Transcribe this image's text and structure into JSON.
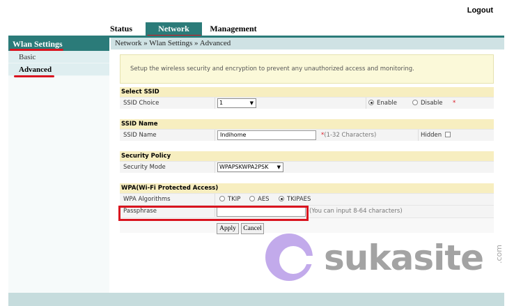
{
  "header": {
    "logout_label": "Logout"
  },
  "tabs": [
    {
      "label": "Status"
    },
    {
      "label": "Network"
    },
    {
      "label": "Management"
    }
  ],
  "sidebar": {
    "title": "Wlan Settings",
    "items": [
      {
        "label": "Basic"
      },
      {
        "label": "Advanced"
      }
    ]
  },
  "breadcrumb": "Network » Wlan Settings » Advanced",
  "info_text": "Setup the wireless security and encryption to prevent any unauthorized access and monitoring.",
  "select_ssid": {
    "title": "Select SSID",
    "label": "SSID Choice",
    "value": "1",
    "enable_label": "Enable",
    "disable_label": "Disable",
    "required_mark": "*"
  },
  "ssid_name": {
    "title": "SSID Name",
    "label": "SSID Name",
    "value": "Indihome",
    "hint": "*(1-32 Characters)",
    "hidden_label": "Hidden"
  },
  "security_policy": {
    "title": "Security Policy",
    "label": "Security Mode",
    "value": "WPAPSKWPA2PSK"
  },
  "wpa": {
    "title": "WPA(Wi-Fi Protected Access)",
    "algorithms_label": "WPA Algorithms",
    "options": [
      "TKIP",
      "AES",
      "TKIPAES"
    ],
    "passphrase_label": "Passphrase",
    "passphrase_value": "",
    "passphrase_hint": "(You can input 8-64 characters)"
  },
  "buttons": {
    "apply": "Apply",
    "cancel": "Cancel"
  },
  "watermark": {
    "text": "sukasite",
    "suffix": ".com"
  },
  "colors": {
    "accent": "#2b7b79",
    "highlight": "#d9141f",
    "section_header": "#f7eec0",
    "logo_purple": "#b79be8"
  }
}
